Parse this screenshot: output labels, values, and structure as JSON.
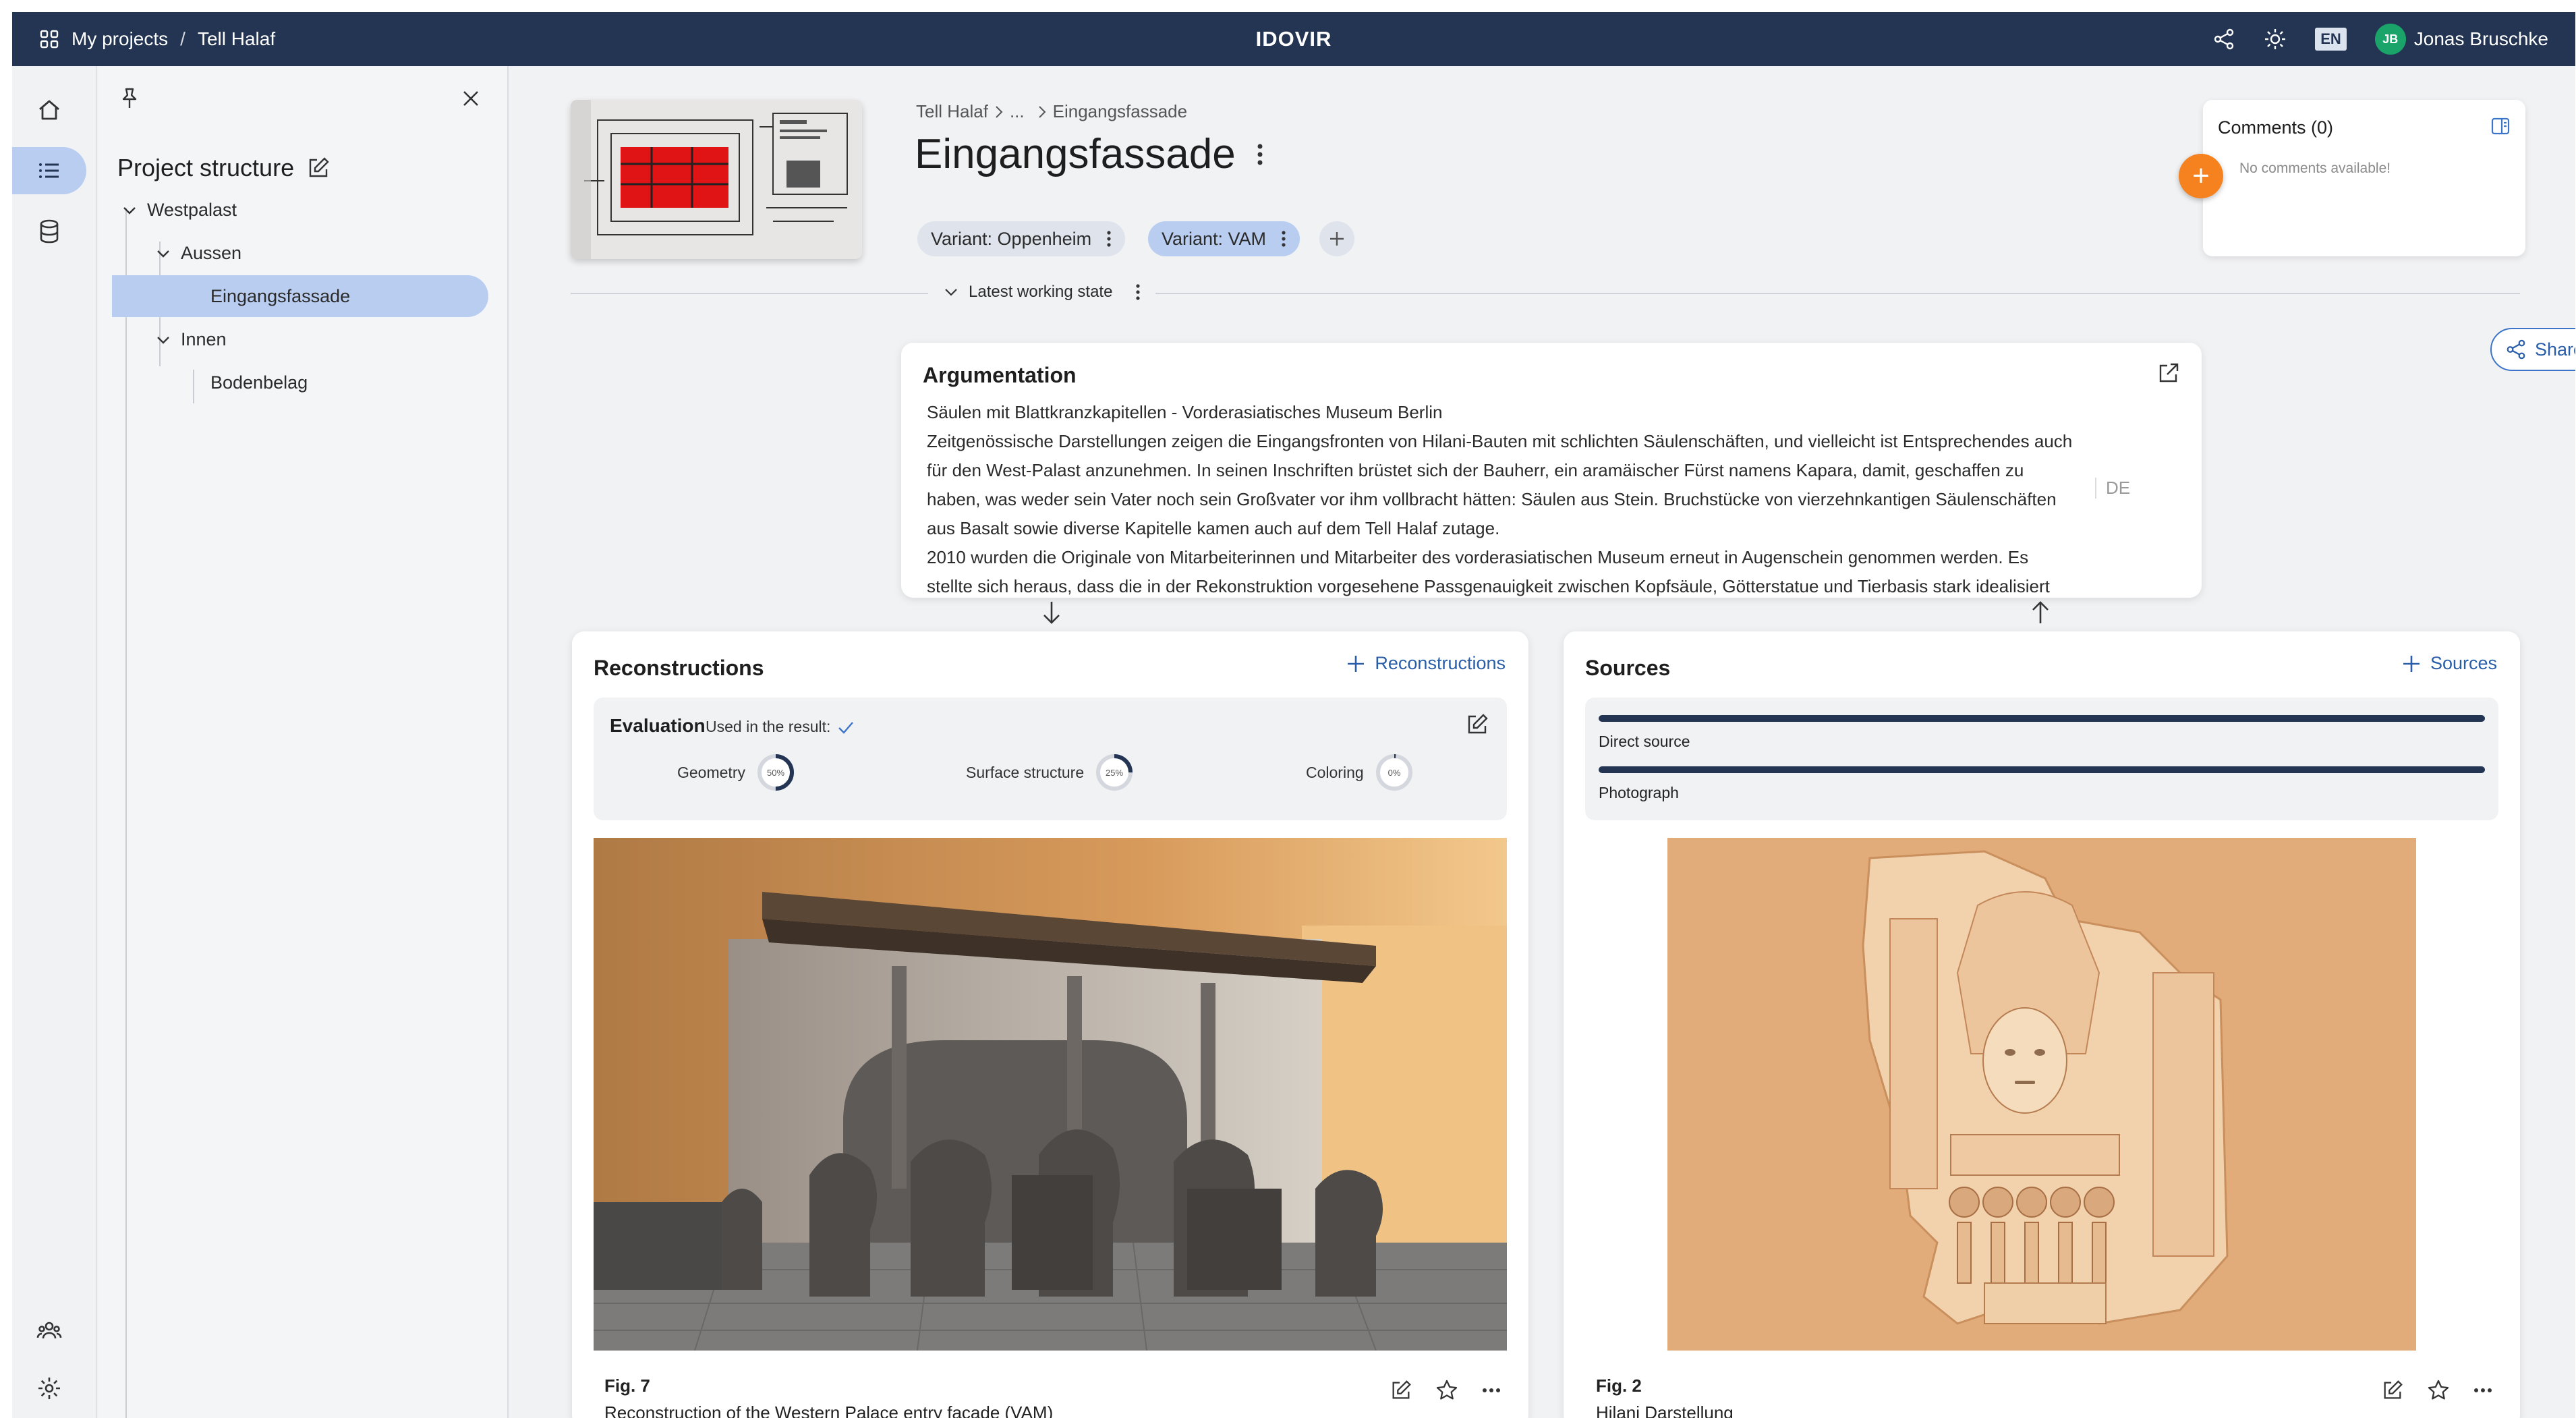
{
  "topbar": {
    "projects_label": "My projects",
    "separator": "/",
    "project_name": "Tell Halaf",
    "app_title": "IDOVIR",
    "language": "EN",
    "user_initials": "JB",
    "user_name": "Jonas Bruschke"
  },
  "tree": {
    "title": "Project structure",
    "items": [
      {
        "label": "Westpalast"
      },
      {
        "label": "Aussen"
      },
      {
        "label": "Eingangsfassade"
      },
      {
        "label": "Innen"
      },
      {
        "label": "Bodenbelag"
      }
    ]
  },
  "header": {
    "breadcrumb": [
      "Tell Halaf",
      "...",
      "Eingangsfassade"
    ],
    "title": "Eingangsfassade",
    "variants": [
      "Variant: Oppenheim",
      "Variant: VAM"
    ],
    "state_label": "Latest working state"
  },
  "comments": {
    "title": "Comments (0)",
    "empty": "No comments available!"
  },
  "share_label": "Share",
  "argumentation": {
    "title": "Argumentation",
    "lines": [
      "Säulen mit Blattkranzkapitellen - Vorderasiatisches Museum Berlin",
      "Zeitgenössische Darstellungen zeigen die Eingangsfronten von Hilani-Bauten mit schlichten Säulenschäften, und vielleicht ist Entsprechendes auch",
      "für den West-Palast anzunehmen. In seinen Inschriften brüstet sich der Bauherr, ein aramäischer Fürst namens Kapara, damit, geschaffen zu",
      "haben, was weder sein Vater noch sein Großvater vor ihm vollbracht hätten: Säulen aus Stein. Bruchstücke von vierzehnkantigen Säulenschäften",
      "aus Basalt sowie diverse Kapitelle kamen auch auf dem Tell Halaf zutage.",
      "2010 wurden die Originale von Mitarbeiterinnen und Mitarbeiter des vorderasiatischen Museum erneut in Augenschein genommen werden. Es",
      "stellte sich heraus, dass die in der Rekonstruktion vorgesehene Passgenauigkeit zwischen Kopfsäule, Götterstatue und Tierbasis stark idealisiert"
    ],
    "language": "DE"
  },
  "reconstructions": {
    "title": "Reconstructions",
    "add_label": "Reconstructions",
    "evaluation_title": "Evaluation",
    "used_label": "Used in the result:",
    "metrics": [
      {
        "label": "Geometry",
        "value": 50,
        "text": "50%"
      },
      {
        "label": "Surface structure",
        "value": 25,
        "text": "25%"
      },
      {
        "label": "Coloring",
        "value": 0,
        "text": "0%"
      }
    ],
    "figure_number": "Fig. 7",
    "figure_caption": "Reconstruction of the Western Palace entry facade (VAM)"
  },
  "sources": {
    "title": "Sources",
    "add_label": "Sources",
    "types": [
      "Direct source",
      "Photograph"
    ],
    "figure_number": "Fig. 2",
    "figure_caption": "Hilani Darstellung"
  },
  "colors": {
    "topbar": "#233553",
    "accent": "#2b5ea8",
    "selection": "#b9cdf0",
    "fab": "#f5821f",
    "avatar": "#1aa46a"
  },
  "icons": [
    "apps-icon",
    "share-icon",
    "brightness-icon",
    "home-icon",
    "list-icon",
    "database-icon",
    "group-icon",
    "settings-icon",
    "pin-icon",
    "close-icon",
    "edit-icon",
    "more-icon",
    "plus-icon",
    "chevron-down-icon",
    "chevron-right-icon",
    "arrow-down-icon",
    "arrow-up-icon",
    "open-external-icon",
    "panel-icon",
    "star-icon",
    "check-icon"
  ]
}
